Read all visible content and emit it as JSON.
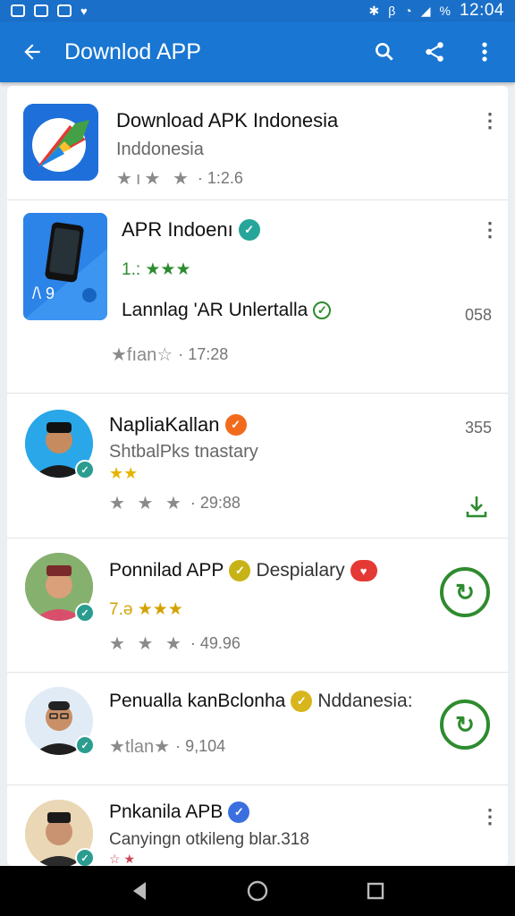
{
  "status_bar": {
    "time": "12:04",
    "battery": "%"
  },
  "app_bar": {
    "title": "Downlod APP"
  },
  "colors": {
    "primary": "#1976d2",
    "status": "#1a6fc9",
    "green": "#2e8b2e",
    "gold": "#e6b400"
  },
  "items": [
    {
      "title": "Download APK Indonesia",
      "subtitle": "Inddonesia",
      "stars": "★ı★ ★",
      "meta": "· 1:2.6"
    },
    {
      "title": "APR Indoenı",
      "rating": "1.: ★★★",
      "tagline": "Lannlag 'AR Unlertalla",
      "count": "058",
      "stars": "★fıan☆",
      "meta": "· 17:28"
    },
    {
      "title": "NapliaKallan",
      "subtitle": "ShtbalPks tnastary",
      "stars_small": "★★",
      "stars": "★ ★ ★",
      "meta": "· 29:88",
      "count": "355"
    },
    {
      "title": "Ponnilad APP",
      "title_extra": "Despialary",
      "rating": "7.ə ★★★",
      "stars": "★ ★ ★",
      "meta": "· 49.96"
    },
    {
      "title": "Penualla kanBclonha",
      "title_extra": "Nddanesia:",
      "stars": "★tlan★",
      "meta": "· 9,104"
    },
    {
      "title": "Pnkanila APB",
      "subtitle": "Canyingn otkileng blar.318",
      "stars": "☆★"
    }
  ]
}
